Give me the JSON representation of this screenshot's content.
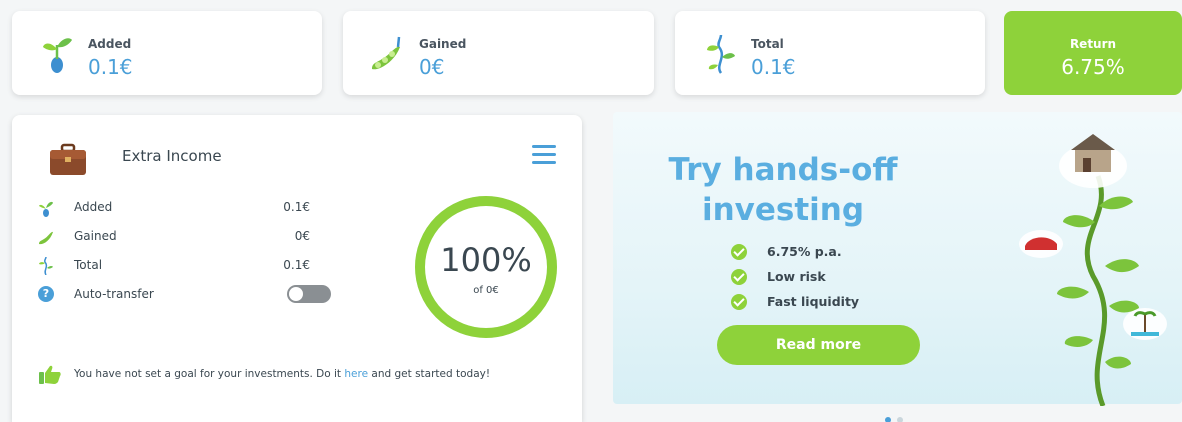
{
  "summary": {
    "added": {
      "label": "Added",
      "value": "0.1€",
      "icon": "sprout-icon"
    },
    "gained": {
      "label": "Gained",
      "value": "0€",
      "icon": "peapod-icon"
    },
    "total": {
      "label": "Total",
      "value": "0.1€",
      "icon": "vine-icon"
    },
    "return": {
      "label": "Return",
      "value": "6.75%"
    }
  },
  "portfolio": {
    "title": "Extra Income",
    "rows": [
      {
        "label": "Added",
        "value": "0.1€"
      },
      {
        "label": "Gained",
        "value": "0€"
      },
      {
        "label": "Total",
        "value": "0.1€"
      }
    ],
    "auto_transfer_label": "Auto-transfer",
    "auto_transfer_on": false,
    "progress": {
      "percent_label": "100%",
      "sub_label": "of 0€",
      "fraction": 1.0
    },
    "goal": {
      "before": "You have not set a goal for your investments. Do it ",
      "link": "here",
      "after": " and get started today!"
    }
  },
  "promo": {
    "title_line1": "Try hands-off",
    "title_line2": "investing",
    "bullets": [
      "6.75% p.a.",
      "Low risk",
      "Fast liquidity"
    ],
    "button": "Read more"
  },
  "colors": {
    "accent_green": "#8ed23a",
    "accent_blue": "#4a9fd8",
    "promo_title": "#5aaee0"
  }
}
